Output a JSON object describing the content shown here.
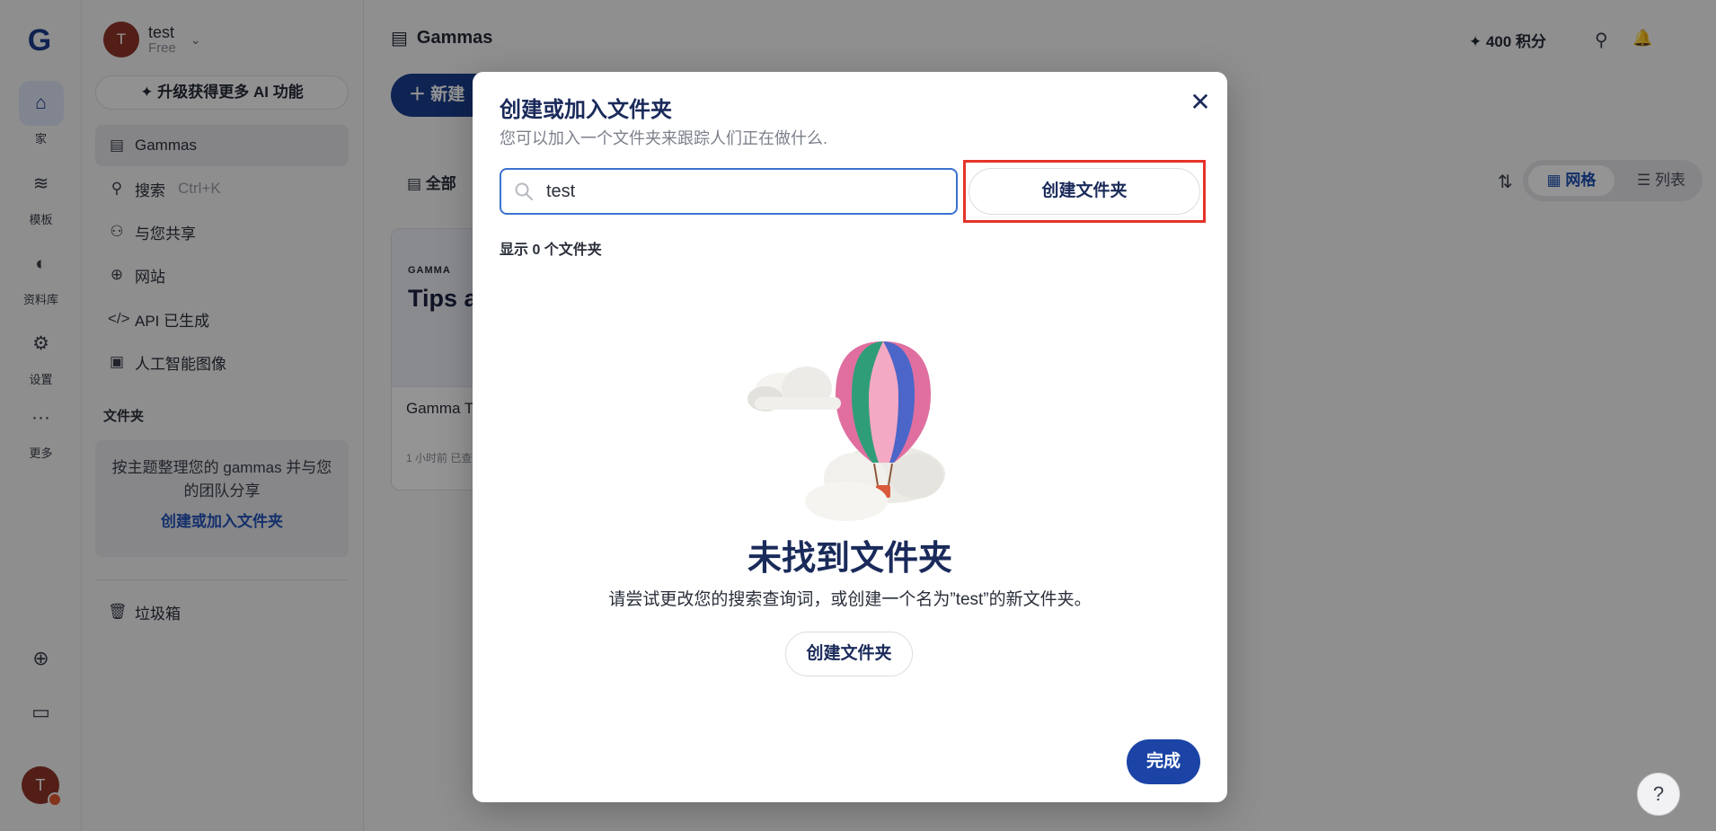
{
  "rail": {
    "logo": "G",
    "items": [
      {
        "label": "家",
        "icon": "home-icon"
      },
      {
        "label": "模板",
        "icon": "layers-icon"
      },
      {
        "label": "资料库",
        "icon": "palette-icon"
      },
      {
        "label": "设置",
        "icon": "gear-icon"
      },
      {
        "label": "更多",
        "icon": "more-icon"
      }
    ],
    "avatar_letter": "T"
  },
  "sidebar": {
    "user": {
      "initial": "T",
      "name": "test",
      "plan": "Free"
    },
    "upgrade_label": "升级获得更多 AI 功能",
    "items": [
      {
        "label": "Gammas",
        "hint": ""
      },
      {
        "label": "搜索",
        "hint": "Ctrl+K"
      },
      {
        "label": "与您共享",
        "hint": ""
      },
      {
        "label": "网站",
        "hint": ""
      },
      {
        "label": "API 已生成",
        "hint": ""
      },
      {
        "label": "人工智能图像",
        "hint": ""
      }
    ],
    "folders_heading": "文件夹",
    "folders_card_text": "按主题整理您的 gammas 并与您的团队分享",
    "folders_card_link": "创建或加入文件夹",
    "trash_label": "垃圾箱"
  },
  "main": {
    "title": "Gammas",
    "credits": "400 积分",
    "new_button": "新建",
    "all_tab": "全部",
    "view_grid": "网格",
    "view_list": "列表",
    "doc_card": {
      "brand": "GAMMA",
      "thumb_title": "Tips a",
      "title": "Gamma T",
      "meta": "1 小时前 已查"
    }
  },
  "modal": {
    "title": "创建或加入文件夹",
    "subtitle": "您可以加入一个文件夹来跟踪人们正在做什么.",
    "search_value": "test",
    "create_button": "创建文件夹",
    "count_text": "显示 0 个文件夹",
    "empty_title": "未找到文件夹",
    "empty_desc": "请尝试更改您的搜索查询词，或创建一个名为”test”的新文件夹。",
    "empty_button": "创建文件夹",
    "done_button": "完成",
    "colors": {
      "accent": "#1b44a6",
      "highlight": "#e63329",
      "focus": "#3a72cf"
    }
  },
  "help_label": "?"
}
